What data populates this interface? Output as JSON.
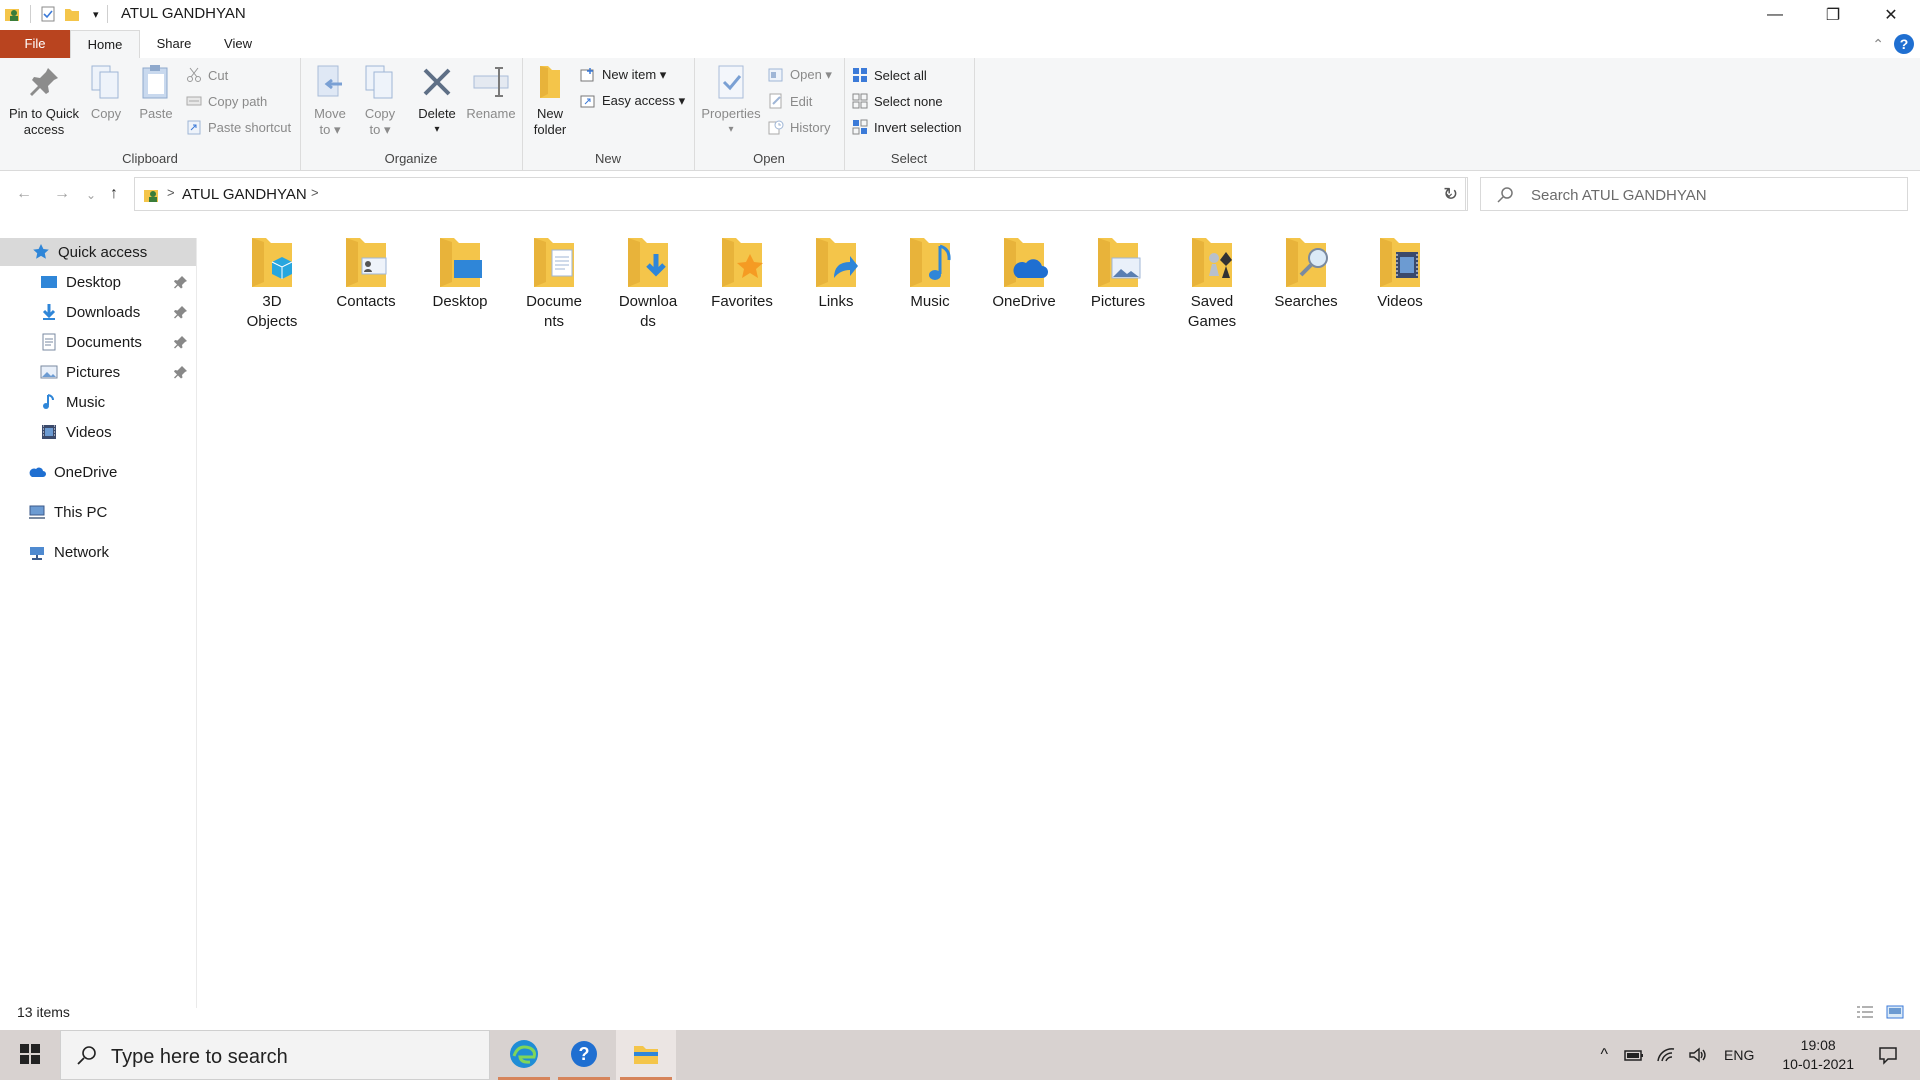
{
  "window": {
    "title": "ATUL GANDHYAN",
    "controls": {
      "minimize": "—",
      "maximize": "❐",
      "close": "✕"
    }
  },
  "quick_access_toolbar": {
    "dropdown": "▾"
  },
  "ribbon_tabs": [
    "File",
    "Home",
    "Share",
    "View"
  ],
  "ribbon_collapse": "⌃",
  "help": "?",
  "ribbon": {
    "clipboard": {
      "label": "Clipboard",
      "pin_label_1": "Pin to Quick",
      "pin_label_2": "access",
      "copy": "Copy",
      "paste": "Paste",
      "cut": "Cut",
      "copy_path": "Copy path",
      "paste_shortcut": "Paste shortcut"
    },
    "organize": {
      "label": "Organize",
      "move_to_1": "Move",
      "move_to_2": "to ▾",
      "copy_to_1": "Copy",
      "copy_to_2": "to ▾",
      "delete": "Delete",
      "delete_arrow": "▾",
      "rename": "Rename"
    },
    "new": {
      "label": "New",
      "new_folder_1": "New",
      "new_folder_2": "folder",
      "new_item": "New item ▾",
      "easy_access": "Easy access ▾"
    },
    "open": {
      "label": "Open",
      "properties": "Properties",
      "properties_arrow": "▾",
      "open": "Open ▾",
      "edit": "Edit",
      "history": "History"
    },
    "select": {
      "label": "Select",
      "select_all": "Select all",
      "select_none": "Select none",
      "invert_selection": "Invert selection"
    }
  },
  "address": {
    "crumb_sep": ">",
    "path": "ATUL GANDHYAN",
    "trailing_sep": ">",
    "dropdown": "⌄",
    "refresh": "↻"
  },
  "nav_buttons": {
    "back": "←",
    "forward": "→",
    "recent": "⌄",
    "up": "↑"
  },
  "search": {
    "placeholder": "Search ATUL GANDHYAN"
  },
  "nav_pane": {
    "quick_access": "Quick access",
    "pinned": [
      "Desktop",
      "Downloads",
      "Documents",
      "Pictures"
    ],
    "unpinned": [
      "Music",
      "Videos"
    ],
    "onedrive": "OneDrive",
    "this_pc": "This PC",
    "network": "Network"
  },
  "folders": [
    {
      "name": "3D Objects",
      "l1": "3D",
      "l2": "Objects",
      "icon": "3d-objects-icon"
    },
    {
      "name": "Contacts",
      "l1": "Contacts",
      "l2": "",
      "icon": "contacts-icon"
    },
    {
      "name": "Desktop",
      "l1": "Desktop",
      "l2": "",
      "icon": "desktop-icon"
    },
    {
      "name": "Documents",
      "l1": "Docume",
      "l2": "nts",
      "icon": "documents-icon"
    },
    {
      "name": "Downloads",
      "l1": "Downloa",
      "l2": "ds",
      "icon": "downloads-icon"
    },
    {
      "name": "Favorites",
      "l1": "Favorites",
      "l2": "",
      "icon": "favorites-icon"
    },
    {
      "name": "Links",
      "l1": "Links",
      "l2": "",
      "icon": "links-icon"
    },
    {
      "name": "Music",
      "l1": "Music",
      "l2": "",
      "icon": "music-icon"
    },
    {
      "name": "OneDrive",
      "l1": "OneDrive",
      "l2": "",
      "icon": "onedrive-icon"
    },
    {
      "name": "Pictures",
      "l1": "Pictures",
      "l2": "",
      "icon": "pictures-icon"
    },
    {
      "name": "Saved Games",
      "l1": "Saved",
      "l2": "Games",
      "icon": "saved-games-icon"
    },
    {
      "name": "Searches",
      "l1": "Searches",
      "l2": "",
      "icon": "searches-icon"
    },
    {
      "name": "Videos",
      "l1": "Videos",
      "l2": "",
      "icon": "videos-icon"
    }
  ],
  "status": {
    "items_count": "13 items"
  },
  "taskbar": {
    "search_placeholder": "Type here to search",
    "tray_chevron": "^",
    "language": "ENG",
    "time": "19:08",
    "date": "10-01-2021"
  },
  "colors": {
    "file_tab": "#b9441f",
    "folder_yellow": "#f4c54a",
    "accent_blue": "#1f6fd1",
    "selected_nav": "#d9d9d9",
    "taskbar": "#d8d2d0"
  }
}
